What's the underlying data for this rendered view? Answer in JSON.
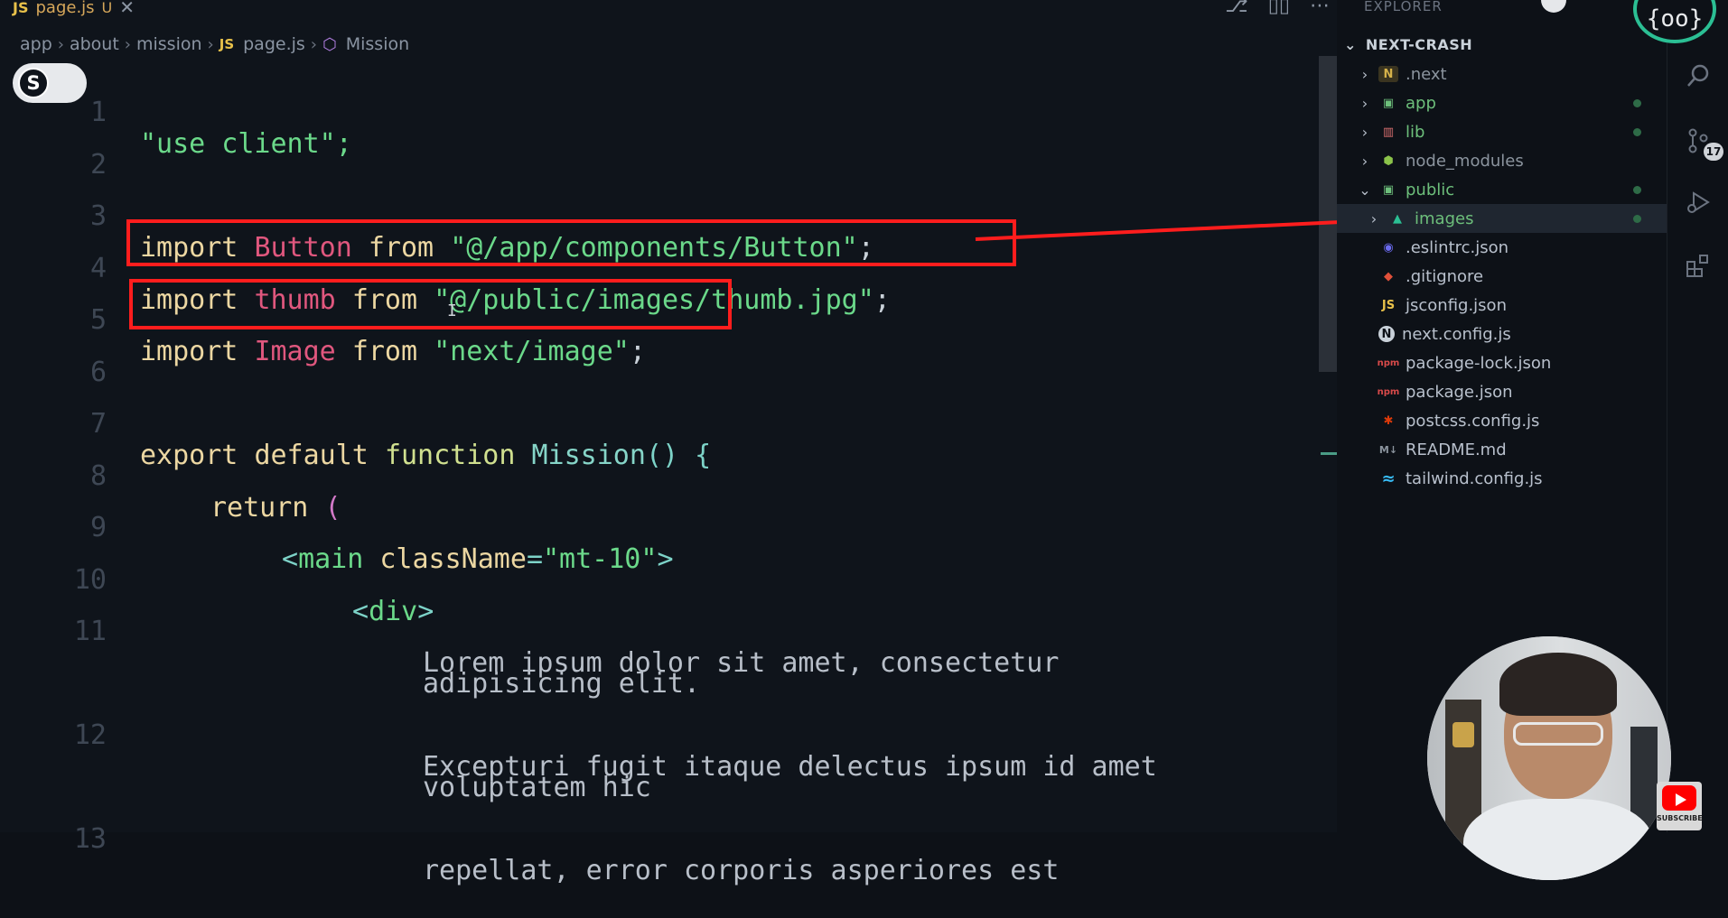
{
  "tab": {
    "lang_badge": "JS",
    "filename": "page.js",
    "status": "U",
    "close": "✕"
  },
  "editor_actions": [
    "⎇",
    "▯▯",
    "⋯"
  ],
  "breadcrumb": {
    "parts": [
      "app",
      "about",
      "mission"
    ],
    "file_badge": "JS",
    "file": "page.js",
    "symbol": "Mission"
  },
  "toggle": {
    "letter": "S"
  },
  "code": {
    "line_numbers": [
      "1",
      "2",
      "3",
      "4",
      "5",
      "6",
      "7",
      "8",
      "9",
      "10",
      "11",
      "12",
      "13"
    ],
    "l1": "\"use client\";",
    "l3": {
      "kw1": "import",
      "id": "Button",
      "kw2": "from",
      "str": "\"@/app/components/Button\"",
      "end": ";"
    },
    "l4": {
      "kw1": "import",
      "id": "thumb",
      "kw2": "from",
      "str": "\"@/public/images/thumb.jpg\"",
      "end": ";"
    },
    "l5": {
      "kw1": "import",
      "id": "Image",
      "kw2": "from",
      "str": "\"next/image\"",
      "end": ";"
    },
    "l7": {
      "kw1": "export",
      "kw2": "default",
      "kw3": "function",
      "name": "Mission",
      "rest": "() {"
    },
    "l8": {
      "kw": "return",
      "paren": "("
    },
    "l9": {
      "open": "<",
      "tag": "main",
      "attr": "className",
      "eq": "=",
      "val": "\"mt-10\"",
      "close": ">"
    },
    "l10": {
      "open": "<",
      "tag": "div",
      "close": ">"
    },
    "l11a": "Lorem ipsum dolor sit amet, consectetur",
    "l11b": "adipisicing elit.",
    "l12a": "Excepturi fugit itaque delectus ipsum id amet",
    "l12b": "voluptatem hic",
    "l13": "repellat, error corporis asperiores est"
  },
  "explorer": {
    "title": "EXPLORER",
    "project": "NEXT-CRASH",
    "items": [
      {
        "label": ".next",
        "icon": "N"
      },
      {
        "label": "app",
        "icon": "▣"
      },
      {
        "label": "lib",
        "icon": "▥"
      },
      {
        "label": "node_modules",
        "icon": "⬢"
      },
      {
        "label": "public",
        "icon": "▣"
      },
      {
        "label": "images",
        "icon": "▲"
      },
      {
        "label": ".eslintrc.json",
        "icon": "◉"
      },
      {
        "label": ".gitignore",
        "icon": "◆"
      },
      {
        "label": "jsconfig.json",
        "icon": "JS"
      },
      {
        "label": "next.config.js",
        "icon": "N"
      },
      {
        "label": "package-lock.json",
        "icon": "npm"
      },
      {
        "label": "package.json",
        "icon": "npm"
      },
      {
        "label": "postcss.config.js",
        "icon": "✱"
      },
      {
        "label": "README.md",
        "icon": "M↓"
      },
      {
        "label": "tailwind.config.js",
        "icon": "≈"
      }
    ]
  },
  "activity": {
    "scm_badge": "17"
  },
  "logo": {
    "text": "{oo}"
  },
  "subscribe": {
    "label": "SUBSCRIBE"
  },
  "colors": {
    "highlight": "#ff1d1d",
    "accent": "#2bbf94",
    "folder_green": "#6dbf7b"
  }
}
